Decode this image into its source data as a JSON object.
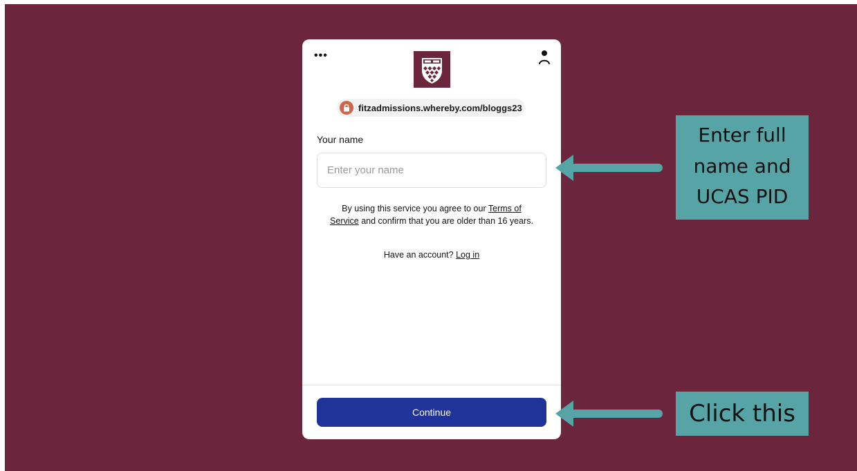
{
  "card": {
    "menu_label": "•••",
    "icons": {
      "menu": "more-dots-icon",
      "user": "user-icon",
      "lock": "lock-icon",
      "logo": "college-crest-logo"
    },
    "url": "fitzadmissions.whereby.com/bloggs23",
    "name_label": "Your name",
    "name_input": {
      "value": "",
      "placeholder": "Enter your name"
    },
    "terms": {
      "prefix": "By using this service you agree to our ",
      "link": "Terms of Service",
      "suffix": " and confirm that you are older than 16 years."
    },
    "login": {
      "prefix": "Have an account? ",
      "link": "Log in"
    },
    "continue_label": "Continue"
  },
  "annotations": {
    "callout_name": [
      "Enter full",
      "name and",
      "UCAS PID"
    ],
    "callout_continue": "Click this"
  },
  "colors": {
    "background": "#6b263e",
    "callout": "#57a4a6",
    "button": "#1f3399",
    "lock_badge": "#d0654b"
  }
}
